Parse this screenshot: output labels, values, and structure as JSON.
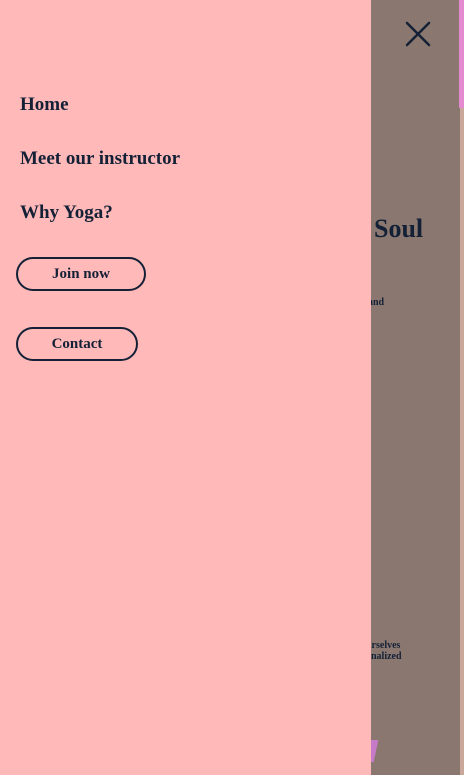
{
  "background": {
    "headline": "Soul",
    "text_fragment_1": "and",
    "text_fragment_2_line1": "urselves",
    "text_fragment_2_line2": "onalized"
  },
  "menu": {
    "items": [
      {
        "label": "Home"
      },
      {
        "label": "Meet our instructor"
      },
      {
        "label": "Why Yoga?"
      }
    ],
    "join_button": "Join now",
    "contact_button": "Contact"
  },
  "close_icon": "close-icon",
  "colors": {
    "drawer_bg": "#ffb9b9",
    "overlay": "#8a7870",
    "text": "#142036",
    "accent": "#e48ad0"
  }
}
